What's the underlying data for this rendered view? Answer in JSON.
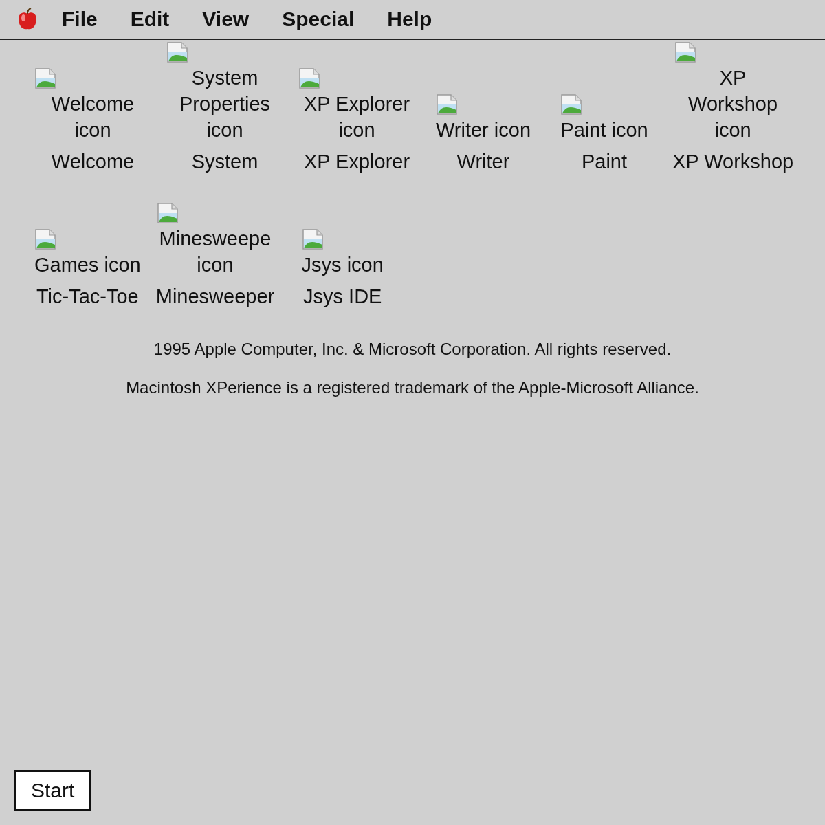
{
  "menu_bar": {
    "items": [
      "File",
      "Edit",
      "View",
      "Special",
      "Help"
    ]
  },
  "desktop_icons": [
    {
      "alt": "Welcome icon",
      "label": "Welcome"
    },
    {
      "alt": "System Properties icon",
      "label": "System"
    },
    {
      "alt": "XP Explorer icon",
      "label": "XP Explorer"
    },
    {
      "alt": "Writer icon",
      "label": "Writer"
    },
    {
      "alt": "Paint icon",
      "label": "Paint"
    },
    {
      "alt": "XP Workshop icon",
      "label": "XP Workshop"
    },
    {
      "alt": "Games icon",
      "label": "Tic-Tac-Toe"
    },
    {
      "alt": "Minesweepe icon",
      "label": "Minesweeper"
    },
    {
      "alt": "Jsys icon",
      "label": "Jsys IDE"
    }
  ],
  "footer": [
    "1995 Apple Computer, Inc. & Microsoft Corporation. All rights reserved.",
    "Macintosh XPerience is a registered trademark of the Apple-Microsoft Alliance."
  ],
  "start_button": {
    "label": "Start"
  }
}
